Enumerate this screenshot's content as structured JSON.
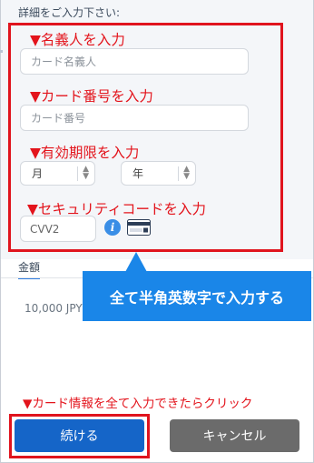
{
  "form": {
    "header": "詳細をご入力下さい:",
    "cardholder": {
      "annotation": "▼名義人を入力",
      "placeholder": "カード名義人"
    },
    "card_number": {
      "annotation": "▼カード番号を入力",
      "placeholder": "カード番号"
    },
    "expiry": {
      "annotation": "▼有効期限を入力",
      "month": "月",
      "year": "年"
    },
    "security_code": {
      "annotation": "▼セキュリティコードを入力",
      "placeholder": "CVV2"
    }
  },
  "amount": {
    "tab_label": "金額",
    "value": "10,000 JPY"
  },
  "tooltip": "全て半角英数字で入力する",
  "bottom_annotation": "▼カード情報を全て入力できたらクリック",
  "buttons": {
    "continue": "続ける",
    "cancel": "キャンセル"
  },
  "icons": {
    "info": "info-icon",
    "card": "card-back-icon",
    "select_arrows": "up-down-arrows-icon"
  },
  "colors": {
    "annotation_red": "#e3141c",
    "primary_blue": "#1565c8",
    "tooltip_blue": "#1a86e8",
    "cancel_gray": "#6b6b6b"
  }
}
